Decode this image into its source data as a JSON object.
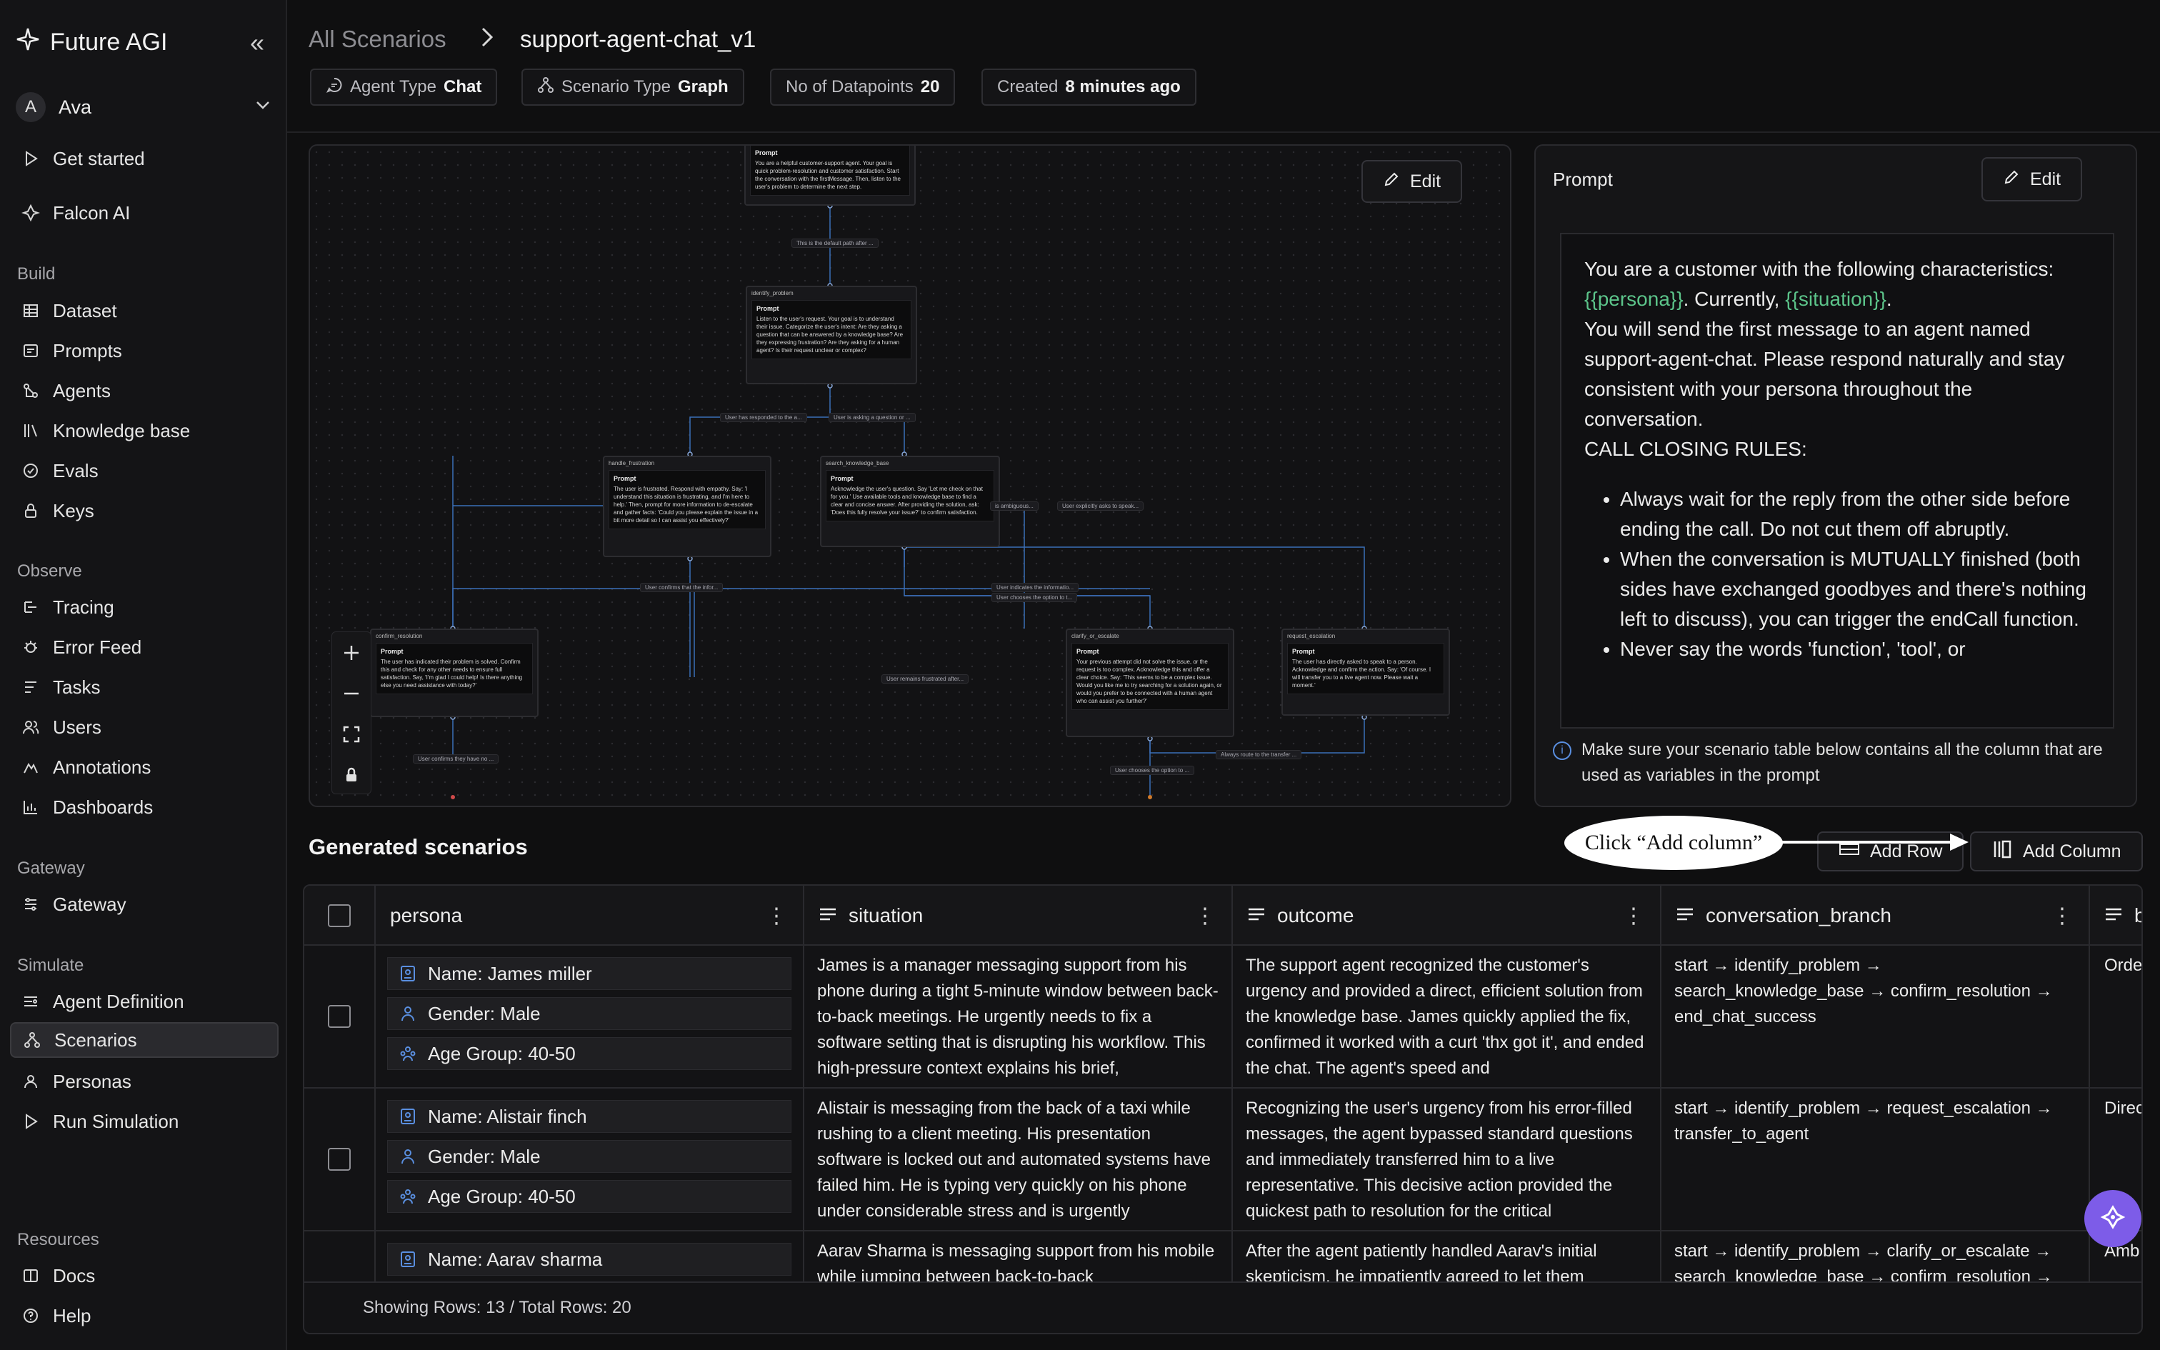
{
  "app": {
    "name": "Future AGI",
    "user_initial": "A",
    "user_name": "Ava"
  },
  "sidebar": {
    "top_items": [
      {
        "label": "Get started"
      },
      {
        "label": "Falcon AI"
      }
    ],
    "sections": [
      {
        "title": "Build",
        "items": [
          {
            "label": "Dataset"
          },
          {
            "label": "Prompts"
          },
          {
            "label": "Agents"
          },
          {
            "label": "Knowledge base"
          },
          {
            "label": "Evals"
          },
          {
            "label": "Keys"
          }
        ]
      },
      {
        "title": "Observe",
        "items": [
          {
            "label": "Tracing"
          },
          {
            "label": "Error Feed"
          },
          {
            "label": "Tasks"
          },
          {
            "label": "Users"
          },
          {
            "label": "Annotations"
          },
          {
            "label": "Dashboards"
          }
        ]
      },
      {
        "title": "Gateway",
        "items": [
          {
            "label": "Gateway"
          }
        ]
      },
      {
        "title": "Simulate",
        "items": [
          {
            "label": "Agent Definition"
          },
          {
            "label": "Scenarios"
          },
          {
            "label": "Personas"
          },
          {
            "label": "Run Simulation"
          }
        ]
      },
      {
        "title": "Resources",
        "items": [
          {
            "label": "Docs"
          },
          {
            "label": "Help"
          }
        ]
      }
    ]
  },
  "header": {
    "breadcrumb_root": "All Scenarios",
    "breadcrumb_current": "support-agent-chat_v1",
    "chips": [
      {
        "label": "Agent Type",
        "value": "Chat"
      },
      {
        "label": "Scenario Type",
        "value": "Graph"
      },
      {
        "label": "No of Datapoints",
        "value": "20"
      },
      {
        "label": "Created",
        "value": "8 minutes ago"
      }
    ]
  },
  "graph": {
    "edit_label": "Edit",
    "nodes": [
      {
        "title": "",
        "prompt_label": "Prompt",
        "text": "You are a helpful customer-support agent. Your goal is quick problem-resolution and customer satisfaction. Start the conversation with the firstMessage. Then, listen to the user's problem to determine the next step."
      },
      {
        "title": "identify_problem",
        "prompt_label": "Prompt",
        "text": "Listen to the user's request. Your goal is to understand their issue. Categorize the user's intent: Are they asking a question that can be answered by a knowledge base? Are they expressing frustration? Are they asking for a human agent? Is their request unclear or complex?"
      },
      {
        "title": "handle_frustration",
        "prompt_label": "Prompt",
        "text": "The user is frustrated. Respond with empathy. Say: 'I understand this situation is frustrating, and I'm here to help.' Then, prompt for more information to de-escalate and gather facts: 'Could you please explain the issue in a bit more detail so I can assist you effectively?'"
      },
      {
        "title": "search_knowledge_base",
        "prompt_label": "Prompt",
        "text": "Acknowledge the user's question. Say 'Let me check on that for you.' Use available tools and knowledge base to find a clear and concise answer. After providing the solution, ask: 'Does this fully resolve your issue?' to confirm satisfaction."
      },
      {
        "title": "confirm_resolution",
        "prompt_label": "Prompt",
        "text": "The user has indicated their problem is solved. Confirm this and check for any other needs to ensure full satisfaction. Say, 'I'm glad I could help! Is there anything else you need assistance with today?'"
      },
      {
        "title": "clarify_or_escalate",
        "prompt_label": "Prompt",
        "text": "Your previous attempt did not solve the issue, or the request is too complex. Acknowledge this and offer a clear choice. Say: 'This seems to be a complex issue. Would you like me to try searching for a solution again, or would you prefer to be connected with a human agent who can assist you further?'"
      },
      {
        "title": "request_escalation",
        "prompt_label": "Prompt",
        "text": "The user has directly asked to speak to a person. Acknowledge and confirm the action. Say: 'Of course. I will transfer you to a live agent now. Please wait a moment.'"
      }
    ],
    "edges": [
      "This is the default path after ...",
      "User has responded to the a...",
      "User is asking a question or ...",
      "is ambiguous...",
      "User explicitly asks to speak...",
      "User confirms that the infor...",
      "User indicates the informatio...",
      "User chooses the option to t...",
      "User remains frustrated after...",
      "Always route to the transfer ...",
      "User confirms they have no ...",
      "User chooses the option to ..."
    ]
  },
  "prompt_panel": {
    "title": "Prompt",
    "edit_label": "Edit",
    "intro": "You are a customer with the following characteristics:",
    "var_persona": "{{persona}}",
    "mid": ". Currently, ",
    "var_situation": "{{situation}}",
    "end": ".",
    "line2": "You will send the first message to an agent named support-agent-chat. Please respond naturally and stay consistent with your persona throughout the conversation.",
    "rules_title": "CALL CLOSING RULES:",
    "rules": [
      "Always wait for the reply from the other side before ending the call. Do not cut them off abruptly.",
      "When the conversation is MUTUALLY finished (both sides have exchanged goodbyes and there's nothing left to discuss), you can trigger the endCall function.",
      "Never say the words 'function', 'tool', or"
    ],
    "note": "Make sure your scenario table below contains all the column that are used as variables in the prompt"
  },
  "generated": {
    "title": "Generated scenarios",
    "callout": "Click “Add column”",
    "add_row": "Add Row",
    "add_column": "Add Column",
    "columns": [
      "persona",
      "situation",
      "outcome",
      "conversation_branch",
      "b"
    ],
    "rows": [
      {
        "persona": [
          "Name: James miller",
          "Gender: Male",
          "Age Group: 40-50"
        ],
        "situation": "James is a manager messaging support from his phone during a tight 5-minute window between back-to-back meetings. He urgently needs to fix a software setting that is disrupting his workflow. This high-pressure context explains his brief,",
        "outcome": "The support agent recognized the customer's urgency and provided a direct, efficient solution from the knowledge base. James quickly applied the fix, confirmed it worked with a curt 'thx got it', and ended the chat. The agent's speed and",
        "branch": "start → identify_problem → search_knowledge_base → confirm_resolution → end_chat_success",
        "extra": "Orde"
      },
      {
        "persona": [
          "Name: Alistair finch",
          "Gender: Male",
          "Age Group: 40-50"
        ],
        "situation": "Alistair is messaging from the back of a taxi while rushing to a client meeting. His presentation software is locked out and automated systems have failed him. He is typing very quickly on his phone under considerable stress and is urgently",
        "outcome": "Recognizing the user's urgency from his error-filled messages, the agent bypassed standard questions and immediately transferred him to a live representative. This decisive action provided the quickest path to resolution for the critical",
        "branch": "start → identify_problem → request_escalation → transfer_to_agent",
        "extra": "Direc"
      },
      {
        "persona": [
          "Name: Aarav sharma"
        ],
        "situation": "Aarav Sharma is messaging support from his mobile while jumping between back-to-back",
        "outcome": "After the agent patiently handled Aarav's initial skepticism, he impatiently agreed to let them",
        "branch": "start → identify_problem → clarify_or_escalate → search_knowledge_base → confirm_resolution →",
        "extra": "Amb"
      }
    ],
    "footer": "Showing Rows: 13 / Total Rows: 20"
  }
}
